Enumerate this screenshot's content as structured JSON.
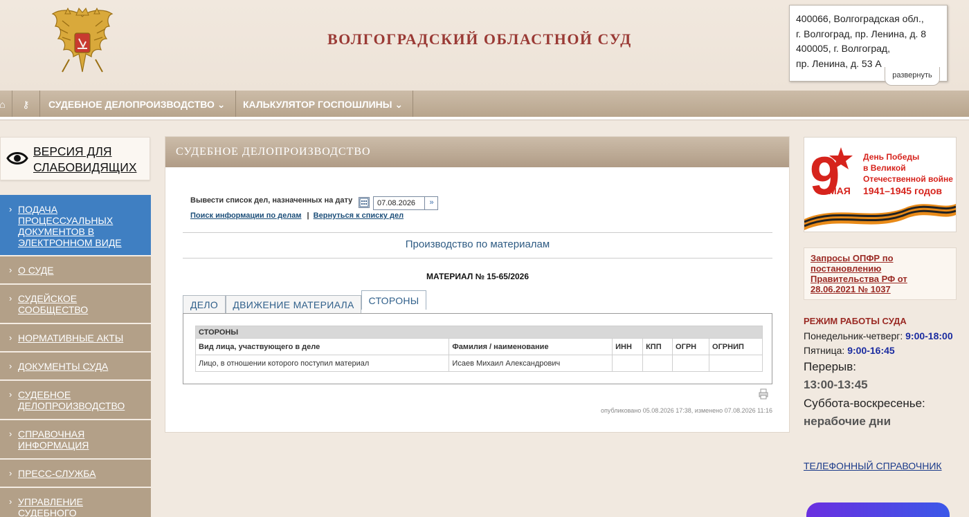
{
  "header": {
    "title": "ВОЛГОГРАДСКИЙ ОБЛАСТНОЙ СУД",
    "address_lines": [
      "400066, Волгоградская обл.,",
      "г. Волгоград, пр. Ленина, д. 8",
      "400005, г. Волгоград,",
      "пр. Ленина, д. 53 А"
    ],
    "expand_label": "развернуть"
  },
  "nav": {
    "home_icon": "⌂",
    "key_icon": "⚷",
    "items": [
      {
        "label": "СУДЕБНОЕ ДЕЛОПРОИЗВОДСТВО ⌄"
      },
      {
        "label": "КАЛЬКУЛЯТОР ГОСПОШЛИНЫ ⌄"
      }
    ]
  },
  "accessibility": {
    "label_line1": "ВЕРСИЯ ДЛЯ",
    "label_line2": "СЛАБОВИДЯЩИХ"
  },
  "sidebar": {
    "items": [
      {
        "label": "ПОДАЧА ПРОЦЕССУАЛЬНЫХ ДОКУМЕНТОВ В ЭЛЕКТРОННОМ ВИДЕ"
      },
      {
        "label": "О СУДЕ"
      },
      {
        "label": "СУДЕЙСКОЕ СООБЩЕСТВО"
      },
      {
        "label": "НОРМАТИВНЫЕ АКТЫ"
      },
      {
        "label": "ДОКУМЕНТЫ СУДА"
      },
      {
        "label": "СУДЕБНОЕ ДЕЛОПРОИЗВОДСТВО"
      },
      {
        "label": "СПРАВОЧНАЯ ИНФОРМАЦИЯ"
      },
      {
        "label": "ПРЕСС-СЛУЖБА"
      },
      {
        "label": "УПРАВЛЕНИЕ СУДЕБНОГО"
      }
    ]
  },
  "main": {
    "section_title": "СУДЕБНОЕ ДЕЛОПРОИЗВОДСТВО",
    "date_label": "Вывести список дел, назначенных на дату",
    "date_value": "07.08.2026",
    "link_search": "Поиск информации по делам",
    "link_separator": "|",
    "link_back": "Вернуться к списку дел",
    "proc_title": "Производство по материалам",
    "material_title": "МАТЕРИАЛ № 15-65/2026",
    "tabs": [
      {
        "label": "ДЕЛО"
      },
      {
        "label": "ДВИЖЕНИЕ МАТЕРИАЛА"
      },
      {
        "label": "СТОРОНЫ"
      }
    ],
    "table": {
      "section": "СТОРОНЫ",
      "headers": [
        "Вид лица, участвующего в деле",
        "Фамилия / наименование",
        "ИНН",
        "КПП",
        "ОГРН",
        "ОГРНИП"
      ],
      "rows": [
        [
          "Лицо, в отношении которого поступил материал",
          "Исаев Михаил Александрович",
          "",
          "",
          "",
          ""
        ]
      ]
    },
    "published": "опубликовано 05.08.2026 17:38, изменено 07.08.2026 11:16"
  },
  "right": {
    "victory_banner": {
      "number": "9",
      "month": "МАЯ",
      "lines": [
        "День Победы",
        "в Великой",
        "Отечественной войне",
        "1941–1945 годов"
      ]
    },
    "opfr_link": "Запросы ОПФР по постановлению Правительства РФ от 28.06.2021 № 1037",
    "regime_title": "РЕЖИМ РАБОТЫ СУДА",
    "mon_thu_label": "Понедельник-четверг:",
    "mon_thu_time": "9:00-18:00",
    "fri_label": "Пятница:",
    "fri_time": "9:00-16:45",
    "break_label": "Перерыв:",
    "break_time": "13:00-13:45",
    "weekend_label": "Суббота-воскресенье:",
    "weekend_value": "нерабочие дни",
    "phonebook": "ТЕЛЕФОННЫЙ СПРАВОЧНИК"
  }
}
